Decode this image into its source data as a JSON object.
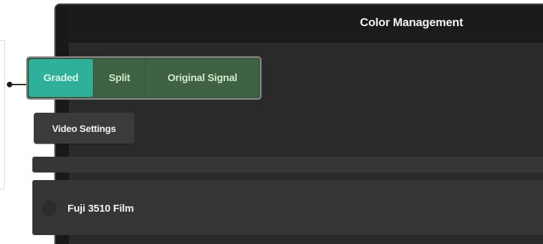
{
  "window": {
    "title": "Color Management"
  },
  "view_mode": {
    "options": [
      {
        "label": "Graded",
        "active": true
      },
      {
        "label": "Split",
        "active": false
      },
      {
        "label": "Original Signal",
        "active": false
      }
    ]
  },
  "video_settings": {
    "label": "Video Settings"
  },
  "lut_list": {
    "items": [
      {
        "label": "Fuji 3510 Film",
        "selected": false
      }
    ]
  },
  "colors": {
    "active_segment": "#2fb09a",
    "segment": "#3e6243",
    "window_bg": "#1f1f1f",
    "panel_bg": "#2a2a2a"
  }
}
